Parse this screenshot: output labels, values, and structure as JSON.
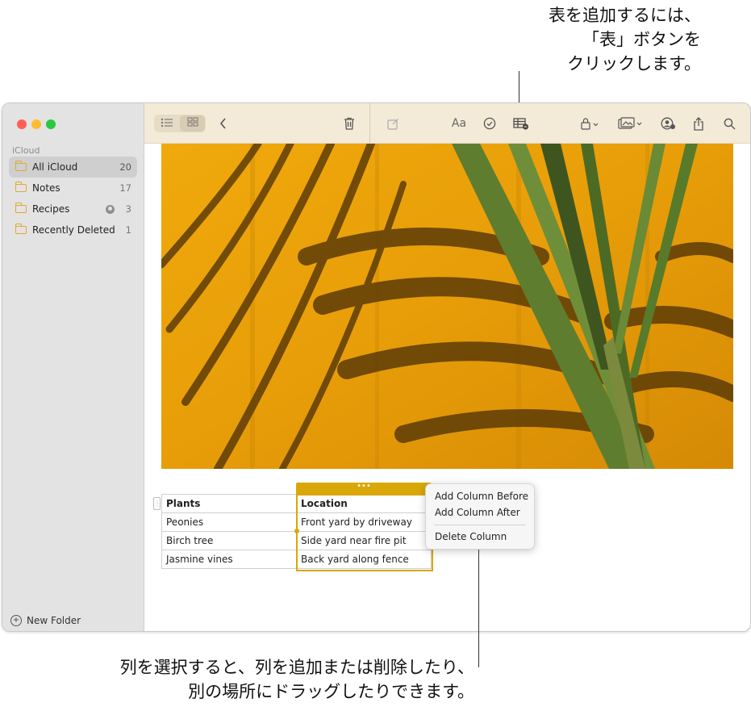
{
  "callouts": {
    "top_lines": [
      "表を追加するには、",
      "「表」ボタンを",
      "クリックします。"
    ],
    "bottom_lines": [
      "列を選択すると、列を追加または削除したり、",
      "別の場所にドラッグしたりできます。"
    ]
  },
  "sidebar": {
    "section_label": "iCloud",
    "folders": [
      {
        "label": "All iCloud",
        "count": "20",
        "selected": true
      },
      {
        "label": "Notes",
        "count": "17"
      },
      {
        "label": "Recipes",
        "count": "3",
        "shared": true
      },
      {
        "label": "Recently Deleted",
        "count": "1"
      }
    ],
    "new_folder_label": "New Folder"
  },
  "toolbar": {
    "format_label": "Aa",
    "icons": [
      "list-view-icon",
      "gallery-view-icon",
      "back-chevron-icon",
      "trash-icon",
      "compose-icon",
      "format-icon",
      "checklist-icon",
      "table-icon",
      "lock-icon",
      "media-icon",
      "collaborate-icon",
      "share-icon",
      "search-icon"
    ]
  },
  "table": {
    "rows": [
      [
        "Plants",
        "Location"
      ],
      [
        "Peonies",
        "Front yard by driveway"
      ],
      [
        "Birch tree",
        "Side yard near fire pit"
      ],
      [
        "Jasmine vines",
        "Back yard along fence"
      ]
    ],
    "column_handle_label": "•••"
  },
  "context_menu": {
    "items": [
      "Add Column Before",
      "Add Column After",
      "Delete Column"
    ]
  },
  "colors": {
    "accent": "#d9a708",
    "toolbar_bg": "#f3ead8",
    "sidebar_bg": "#e3e3e3",
    "folder_icon": "#e0a92e"
  }
}
